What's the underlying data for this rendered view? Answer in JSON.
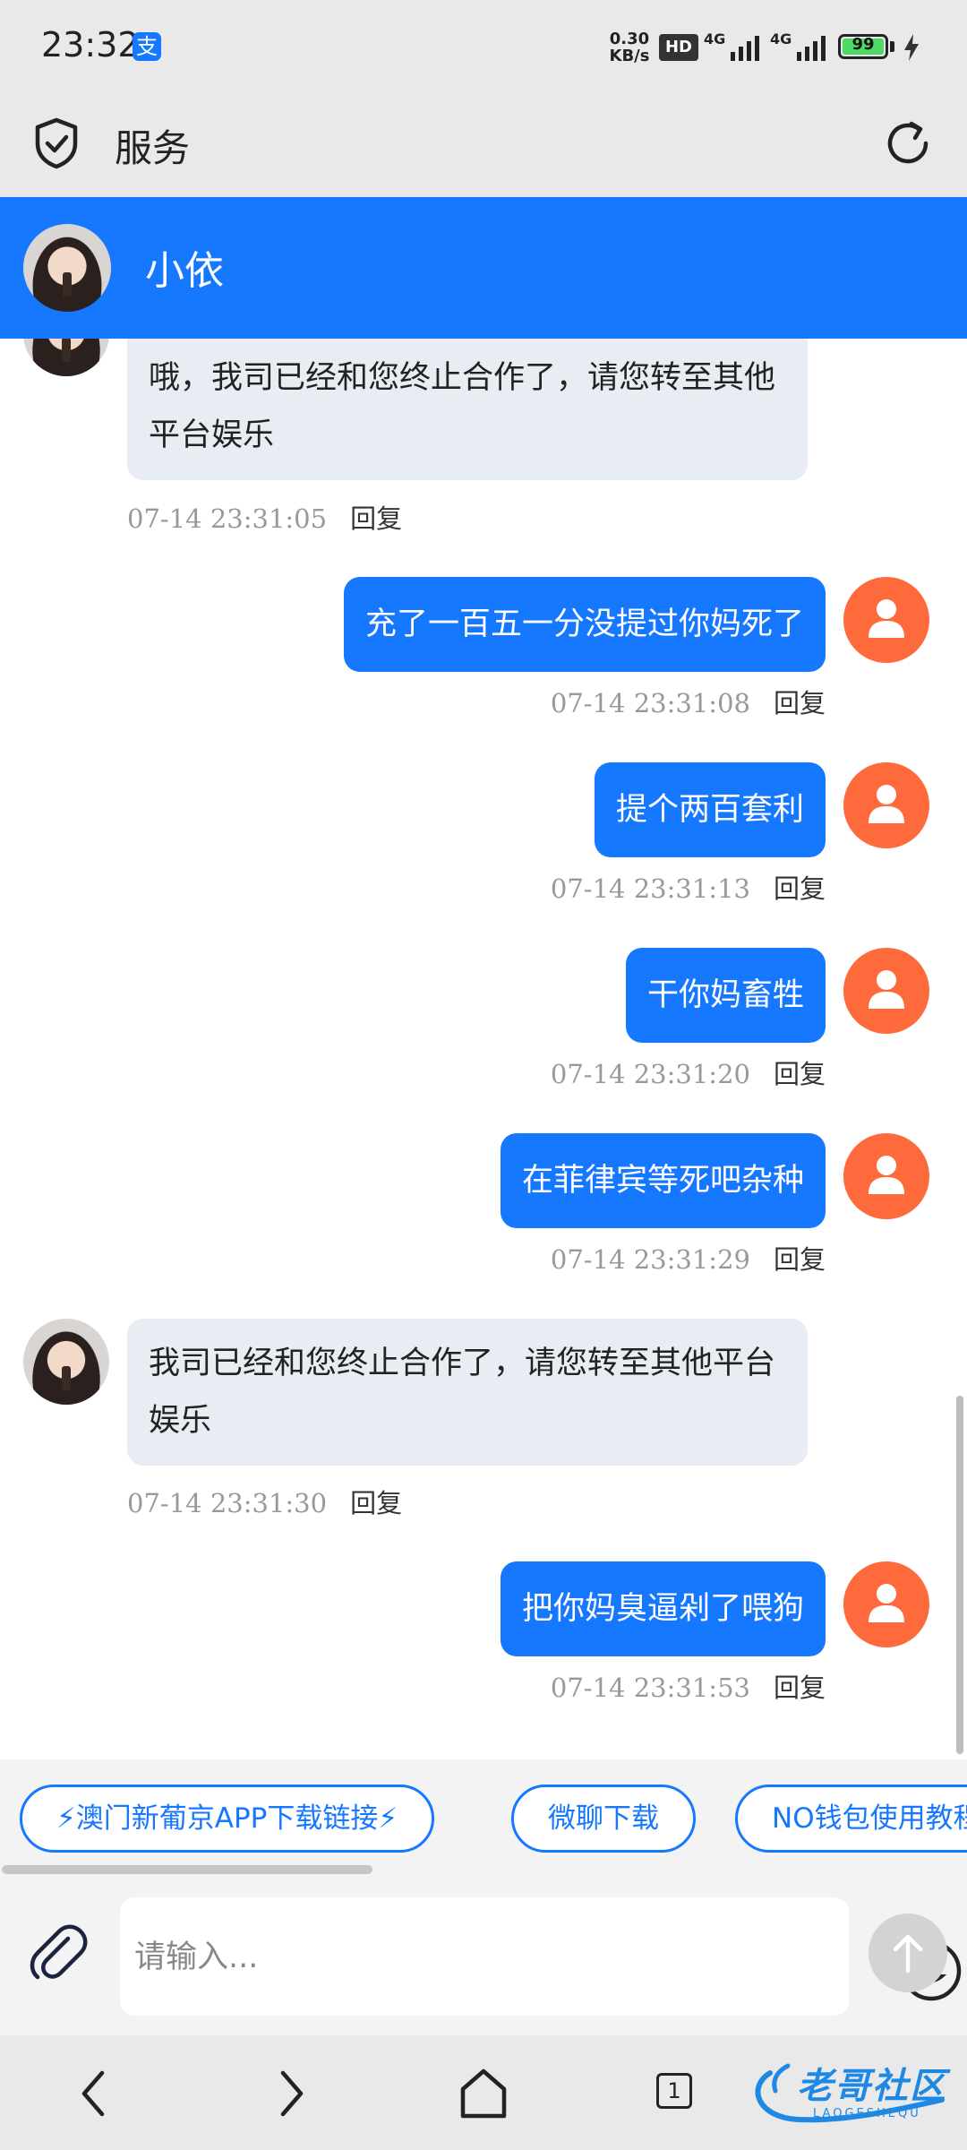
{
  "status_bar": {
    "time": "23:32",
    "alipay_badge": "支",
    "net_speed_value": "0.30",
    "net_speed_unit": "KB/s",
    "hd_label": "HD",
    "signal_1_label": "4G",
    "signal_2_label": "4G",
    "battery_level": "99",
    "battery_fraction": 0.99,
    "battery_color": "#4cd964"
  },
  "topbar": {
    "title": "服务",
    "shield_icon": "shield-check-icon",
    "refresh_icon": "refresh-icon"
  },
  "chat_header": {
    "agent_name": "小依",
    "color": "#1677ff"
  },
  "messages": [
    {
      "side": "in",
      "text": "哦，我司已经和您终止合作了，请您转至其他平台娱乐",
      "timestamp": "07-14 23:31:05",
      "reply": "回复"
    },
    {
      "side": "out",
      "text": "充了一百五一分没提过你妈死了",
      "timestamp": "07-14 23:31:08",
      "reply": "回复"
    },
    {
      "side": "out",
      "text": "提个两百套利",
      "timestamp": "07-14 23:31:13",
      "reply": "回复"
    },
    {
      "side": "out",
      "text": "干你妈畜牲",
      "timestamp": "07-14 23:31:20",
      "reply": "回复"
    },
    {
      "side": "out",
      "text": "在菲律宾等死吧杂种",
      "timestamp": "07-14 23:31:29",
      "reply": "回复"
    },
    {
      "side": "in",
      "text": "我司已经和您终止合作了，请您转至其他平台娱乐",
      "timestamp": "07-14 23:31:30",
      "reply": "回复"
    },
    {
      "side": "out",
      "text": "把你妈臭逼剁了喂狗",
      "timestamp": "07-14 23:31:53",
      "reply": "回复"
    }
  ],
  "quick_links": [
    "⚡澳门新葡京APP下载链接⚡",
    "微聊下载",
    "NO钱包使用教程"
  ],
  "input": {
    "placeholder": "请输入...",
    "value": ""
  },
  "nav": {
    "tab_count": "1"
  },
  "watermark": {
    "text": "老哥社区",
    "sub": "LAOGESHEQU"
  },
  "colors": {
    "accent": "#1677ff",
    "user_avatar": "#ff6a3d",
    "incoming_bubble": "#e8ecf3"
  }
}
